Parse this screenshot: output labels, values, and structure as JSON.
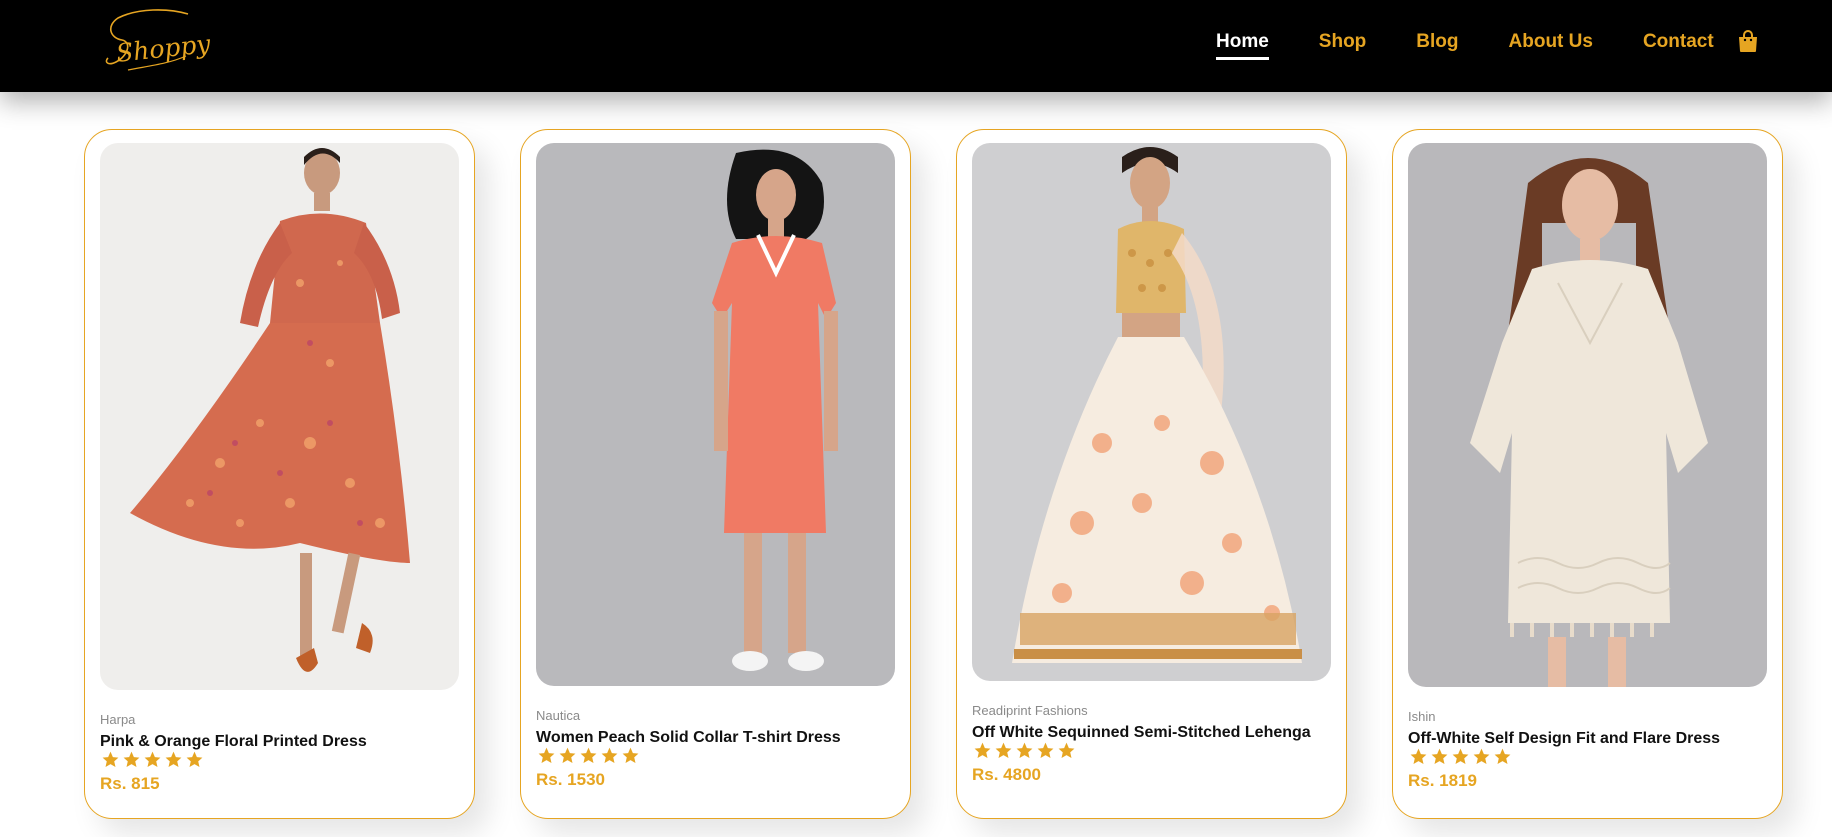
{
  "header": {
    "logo_text": "Shoppy",
    "nav": [
      "Home",
      "Shop",
      "Blog",
      "About Us",
      "Contact"
    ],
    "active_nav": "Home",
    "cart_icon": "shopping-bag-icon"
  },
  "colors": {
    "accent": "#e6a522",
    "navbar_bg": "#000000",
    "text": "#111111",
    "muted": "#8a8a8a"
  },
  "products": [
    {
      "brand": "Harpa",
      "name": "Pink & Orange Floral Printed Dress",
      "rating": 5,
      "price": "Rs. 815"
    },
    {
      "brand": "Nautica",
      "name": "Women Peach Solid Collar T-shirt Dress",
      "rating": 5,
      "price": "Rs. 1530"
    },
    {
      "brand": "Readiprint Fashions",
      "name": "Off White Sequinned Semi-Stitched Lehenga",
      "rating": 5,
      "price": "Rs. 4800"
    },
    {
      "brand": "Ishin",
      "name": "Off-White Self Design Fit and Flare Dress",
      "rating": 5,
      "price": "Rs. 1819"
    }
  ]
}
